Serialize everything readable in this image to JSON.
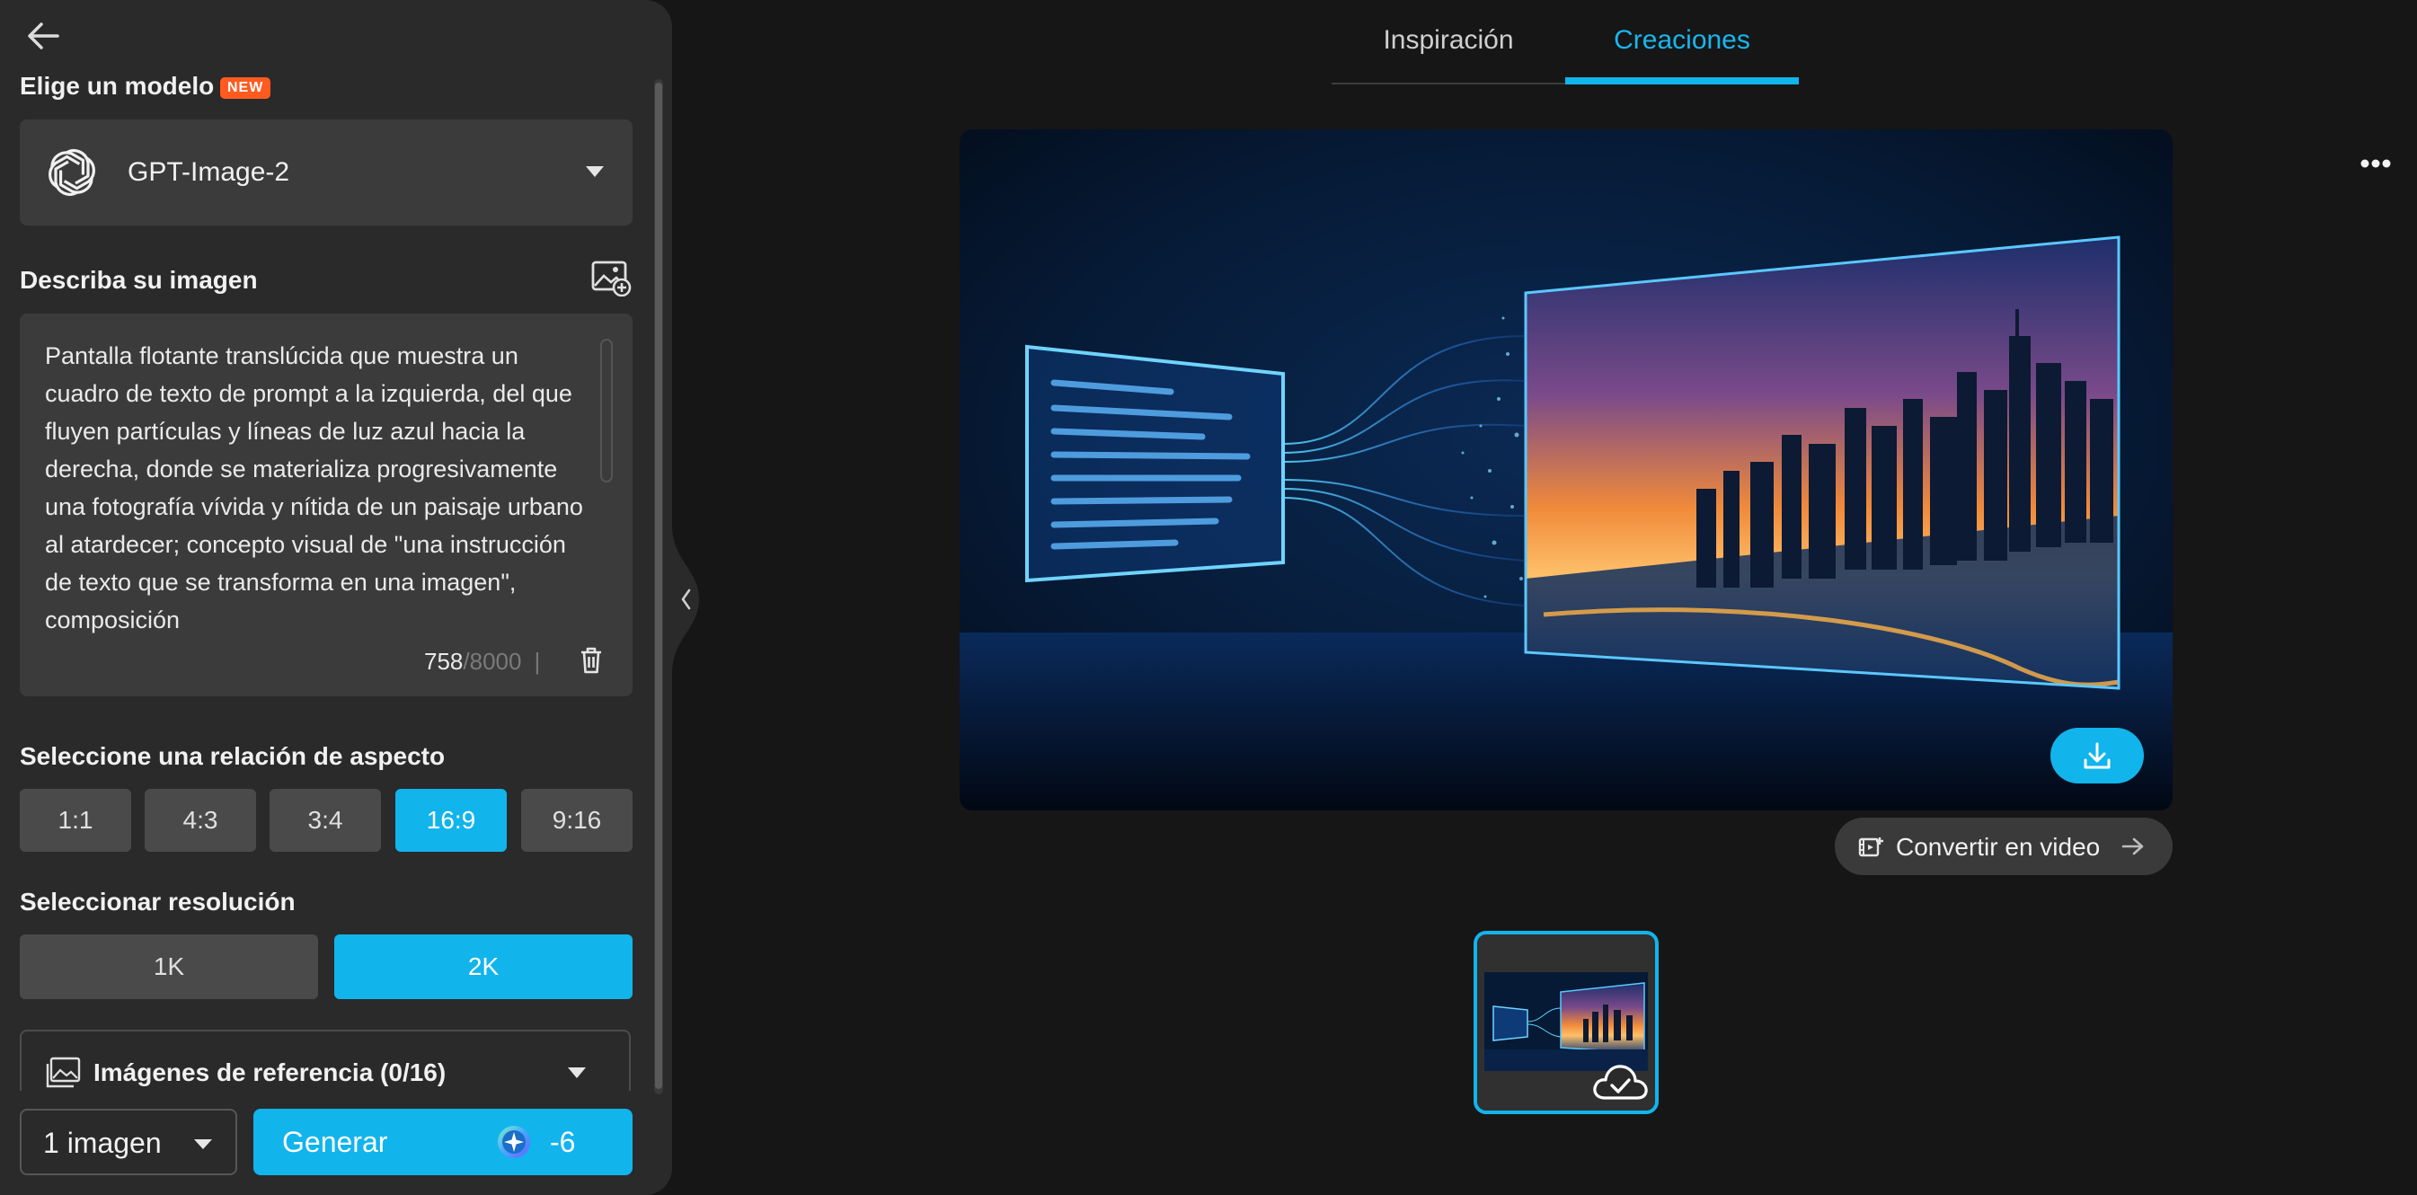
{
  "sidebar": {
    "model_label": "Elige un modelo",
    "new_badge": "NEW",
    "model_name": "GPT-Image-2",
    "describe_label": "Describa su imagen",
    "prompt": "Pantalla flotante translúcida que muestra un cuadro de texto de prompt a la izquierda, del que fluyen partículas y líneas de luz azul hacia la derecha, donde se materializa progresivamente una fotografía vívida y nítida de un paisaje urbano al atardecer; concepto visual de \"una instrucción de texto que se transforma en una imagen\", composición",
    "char_count": "758",
    "char_max": "/8000",
    "char_sep": "|",
    "aspect_label": "Seleccione una relación de aspecto",
    "aspect_ratios": [
      "1:1",
      "4:3",
      "3:4",
      "16:9",
      "9:16"
    ],
    "aspect_selected": "16:9",
    "resolution_label": "Seleccionar resolución",
    "resolutions": [
      "1K",
      "2K"
    ],
    "resolution_selected": "2K",
    "reference_label": "Imágenes de referencia (0/16)",
    "count_value": "1 imagen",
    "generate_label": "Generar",
    "generate_cost": "-6"
  },
  "main": {
    "tabs": [
      {
        "label": "Inspiración",
        "active": false
      },
      {
        "label": "Creaciones",
        "active": true
      }
    ],
    "convert_label": "Convertir en video"
  },
  "colors": {
    "accent": "#12b4ec",
    "panel_bg": "#2a2a2a",
    "page_bg": "#161616",
    "badge": "#ff5a1f"
  },
  "icons": [
    "back-arrow-icon",
    "openai-logo-icon",
    "chevron-down-icon",
    "image-add-icon",
    "trash-icon",
    "gallery-icon",
    "credit-star-icon",
    "chevron-left-icon",
    "more-horizontal-icon",
    "download-icon",
    "video-icon",
    "arrow-right-icon",
    "cloud-check-icon"
  ]
}
